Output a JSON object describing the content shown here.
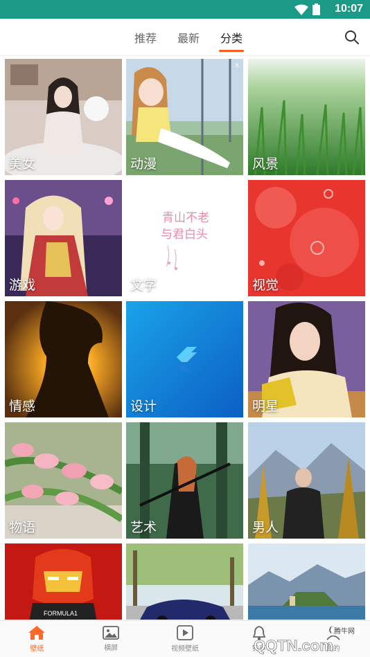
{
  "status_bar": {
    "time": "10:07",
    "bg_color": "#1a9a87",
    "icons": [
      "wifi-icon",
      "battery-icon"
    ]
  },
  "top_nav": {
    "tabs": [
      {
        "label": "推荐",
        "active": false
      },
      {
        "label": "最新",
        "active": false
      },
      {
        "label": "分类",
        "active": true
      }
    ],
    "accent_color": "#ff5a1f",
    "search_icon": "search-icon"
  },
  "categories": [
    {
      "label": "美女"
    },
    {
      "label": "动漫"
    },
    {
      "label": "风景"
    },
    {
      "label": "游戏"
    },
    {
      "label": "文字"
    },
    {
      "label": "视觉"
    },
    {
      "label": "情感"
    },
    {
      "label": "设计"
    },
    {
      "label": "明星"
    },
    {
      "label": "物语"
    },
    {
      "label": "艺术"
    },
    {
      "label": "男人"
    }
  ],
  "text_tile_art": {
    "line1": "青山不老",
    "line2": "与君白头"
  },
  "tile_badges": {
    "anime_corner": "K",
    "ironman_band": "FORMULA1"
  },
  "bottom_nav": {
    "items": [
      {
        "label": "壁纸",
        "icon": "home-icon",
        "active": true
      },
      {
        "label": "横屏",
        "icon": "image-icon",
        "active": false
      },
      {
        "label": "视频壁纸",
        "icon": "play-icon",
        "active": false
      },
      {
        "label": "铃声",
        "icon": "bell-icon",
        "active": false
      },
      {
        "label": "我的",
        "icon": "user-icon",
        "active": false
      }
    ],
    "active_color": "#ff6a2c"
  },
  "watermark": {
    "top_text": "腾牛网",
    "main_text": "QQTN.com"
  }
}
